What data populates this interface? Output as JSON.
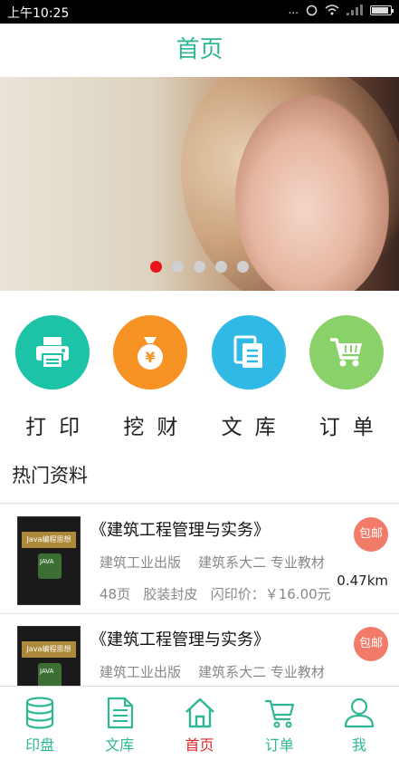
{
  "status_bar": {
    "time": "上午10:25",
    "dots": "...",
    "battery_level": 0.9
  },
  "header": {
    "title": "首页"
  },
  "banner": {
    "dots": 5,
    "active_dot": 0
  },
  "quick_actions": [
    {
      "label": "打印",
      "icon": "printer-icon",
      "color": "#1cc3a6"
    },
    {
      "label": "挖财",
      "icon": "money-bag-icon",
      "color": "#f79225"
    },
    {
      "label": "文库",
      "icon": "documents-icon",
      "color": "#2fb9e4"
    },
    {
      "label": "订单",
      "icon": "cart-icon",
      "color": "#8bd16a"
    }
  ],
  "hot": {
    "title": "热门资料",
    "items": [
      {
        "title": "《建筑工程管理与实务》",
        "publisher": "建筑工业出版",
        "tags": "建筑系大二 专业教材",
        "pages": "48页",
        "binding": "胶装封皮",
        "price": "闪印价：￥16.00元",
        "badge": "包邮",
        "distance": "0.47km",
        "cover_text": "Java编程思想",
        "cover_sub": "JAVA"
      },
      {
        "title": "《建筑工程管理与实务》",
        "publisher": "建筑工业出版",
        "tags": "建筑系大二 专业教材",
        "badge": "包邮",
        "cover_text": "Java编程思想",
        "cover_sub": "JAVA"
      }
    ]
  },
  "tabbar": {
    "tabs": [
      {
        "label": "印盘",
        "icon": "database-icon"
      },
      {
        "label": "文库",
        "icon": "document-icon"
      },
      {
        "label": "首页",
        "icon": "home-icon",
        "active": true
      },
      {
        "label": "订单",
        "icon": "cart-icon"
      },
      {
        "label": "我",
        "icon": "user-icon"
      }
    ],
    "accent": "#2fb795",
    "active_color": "#e0262b"
  }
}
